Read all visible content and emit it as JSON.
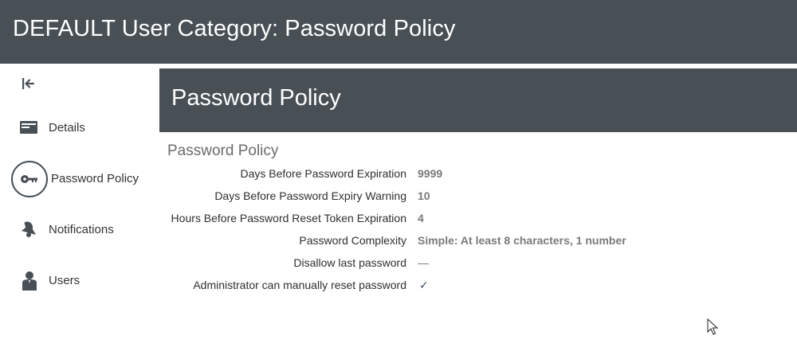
{
  "header": {
    "title": "DEFAULT User Category: Password Policy"
  },
  "sidebar": {
    "collapse_icon": "collapse-left-icon",
    "items": [
      {
        "label": "Details",
        "icon": "details-card-icon",
        "active": false
      },
      {
        "label": "Password Policy",
        "icon": "key-icon",
        "active": true
      },
      {
        "label": "Notifications",
        "icon": "bell-icon",
        "active": false
      },
      {
        "label": "Users",
        "icon": "user-icon",
        "active": false
      }
    ]
  },
  "panel": {
    "title": "Password Policy",
    "section_title": "Password Policy",
    "rows": [
      {
        "label": "Days Before Password Expiration",
        "value": "9999"
      },
      {
        "label": "Days Before Password Expiry Warning",
        "value": "10"
      },
      {
        "label": "Hours Before Password Reset Token Expiration",
        "value": "4"
      },
      {
        "label": "Password Complexity",
        "value": "Simple: At least 8 characters, 1 number"
      },
      {
        "label": "Disallow last password",
        "value": "—"
      },
      {
        "label": "Administrator can manually reset password",
        "value": "✓"
      }
    ]
  },
  "colors": {
    "header_bg": "#485056",
    "text": "#333333",
    "value": "#777777"
  }
}
